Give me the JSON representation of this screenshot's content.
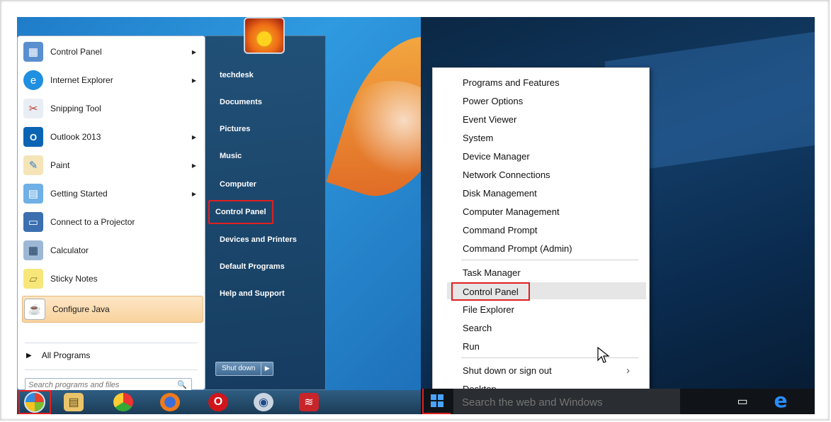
{
  "win7": {
    "programs": [
      {
        "label": "Control Panel",
        "icon": "control-panel-icon",
        "arrow": true
      },
      {
        "label": "Internet Explorer",
        "icon": "internet-explorer-icon",
        "arrow": true
      },
      {
        "label": "Snipping Tool",
        "icon": "scissors-icon",
        "arrow": false
      },
      {
        "label": "Outlook 2013",
        "icon": "outlook-icon",
        "arrow": true
      },
      {
        "label": "Paint",
        "icon": "paint-palette-icon",
        "arrow": true
      },
      {
        "label": "Getting Started",
        "icon": "getting-started-icon",
        "arrow": true
      },
      {
        "label": "Connect to a Projector",
        "icon": "projector-icon",
        "arrow": false
      },
      {
        "label": "Calculator",
        "icon": "calculator-icon",
        "arrow": false
      },
      {
        "label": "Sticky Notes",
        "icon": "sticky-notes-icon",
        "arrow": false
      },
      {
        "label": "Configure Java",
        "icon": "java-icon",
        "arrow": false
      }
    ],
    "all_programs": "All Programs",
    "search_placeholder": "Search programs and files",
    "right_links": [
      "techdesk",
      "Documents",
      "Pictures",
      "Music",
      "Computer",
      "Control Panel",
      "Devices and Printers",
      "Default Programs",
      "Help and Support"
    ],
    "shutdown_label": "Shut down",
    "taskbar_icons": [
      "start-orb-icon",
      "explorer-folder-icon",
      "chrome-icon",
      "firefox-icon",
      "opera-icon",
      "browser-globe-icon",
      "wifi-app-icon"
    ]
  },
  "win10": {
    "menu_group1": [
      "Programs and Features",
      "Power Options",
      "Event Viewer",
      "System",
      "Device Manager",
      "Network Connections",
      "Disk Management",
      "Computer Management",
      "Command Prompt",
      "Command Prompt (Admin)"
    ],
    "menu_group2": [
      "Task Manager",
      "Control Panel",
      "File Explorer",
      "Search",
      "Run"
    ],
    "menu_group3": [
      "Shut down or sign out",
      "Desktop"
    ],
    "search_placeholder": "Search the web and Windows"
  }
}
